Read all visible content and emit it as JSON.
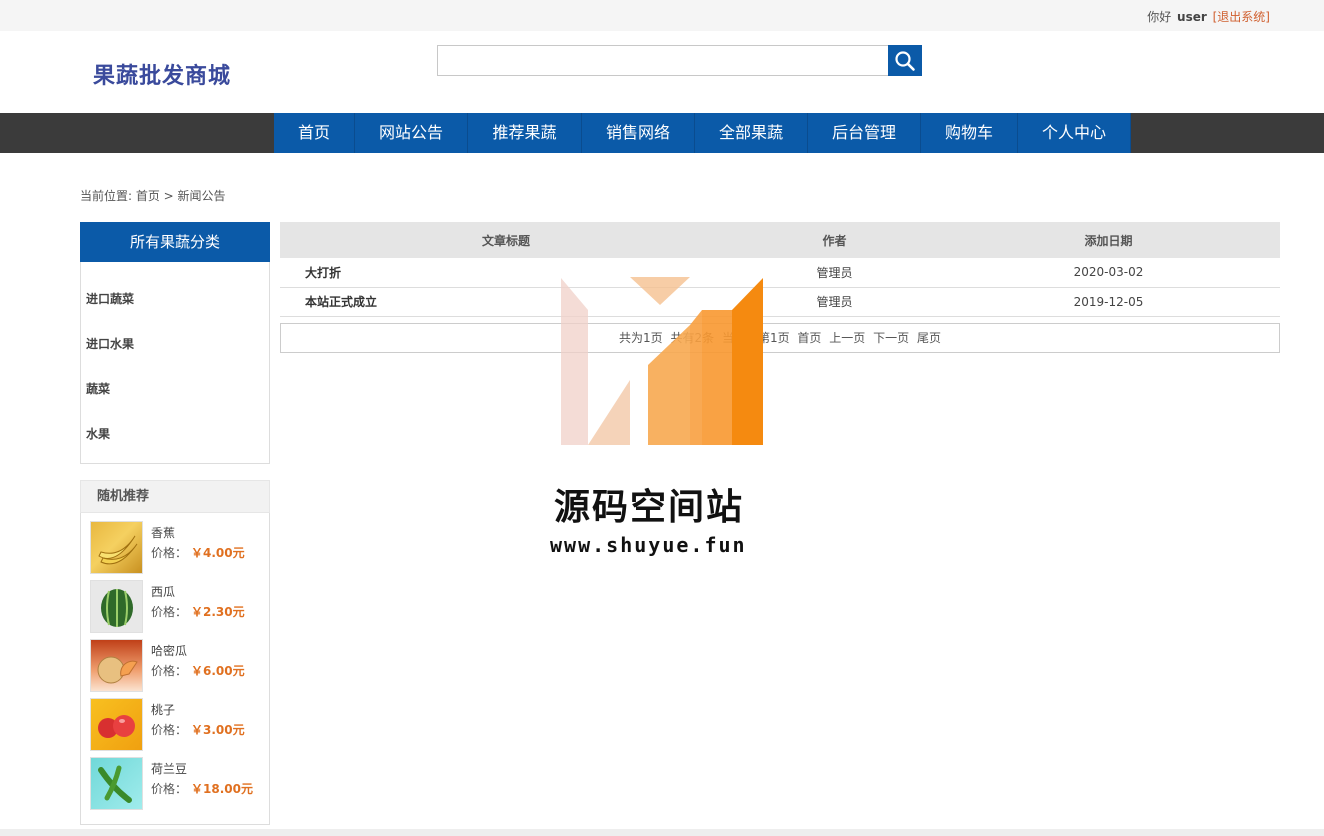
{
  "topbar": {
    "greeting": "你好",
    "username": "user",
    "logout": "[退出系统]"
  },
  "header": {
    "logo": "果蔬批发商城",
    "search_placeholder": ""
  },
  "nav": [
    "首页",
    "网站公告",
    "推荐果蔬",
    "销售网络",
    "全部果蔬",
    "后台管理",
    "购物车",
    "个人中心"
  ],
  "breadcrumb": "当前位置: 首页 > 新闻公告",
  "sidebar": {
    "category_title": "所有果蔬分类",
    "categories": [
      "进口蔬菜",
      "进口水果",
      "蔬菜",
      "水果"
    ],
    "recommend_title": "随机推荐",
    "price_label": "价格：",
    "items": [
      {
        "name": "香蕉",
        "price": "￥4.00元"
      },
      {
        "name": "西瓜",
        "price": "￥2.30元"
      },
      {
        "name": "哈密瓜",
        "price": "￥6.00元"
      },
      {
        "name": "桃子",
        "price": "￥3.00元"
      },
      {
        "name": "荷兰豆",
        "price": "￥18.00元"
      }
    ]
  },
  "table": {
    "headers": [
      "文章标题",
      "作者",
      "添加日期"
    ],
    "rows": [
      [
        "大打折",
        "管理员",
        "2020-03-02"
      ],
      [
        "本站正式成立",
        "管理员",
        "2019-12-05"
      ]
    ]
  },
  "pager": [
    "共为1页",
    "共有2条",
    "当前为第1页",
    "首页",
    "上一页",
    "下一页",
    "尾页"
  ],
  "watermark": {
    "title": "源码空间站",
    "url": "www.shuyue.fun"
  }
}
